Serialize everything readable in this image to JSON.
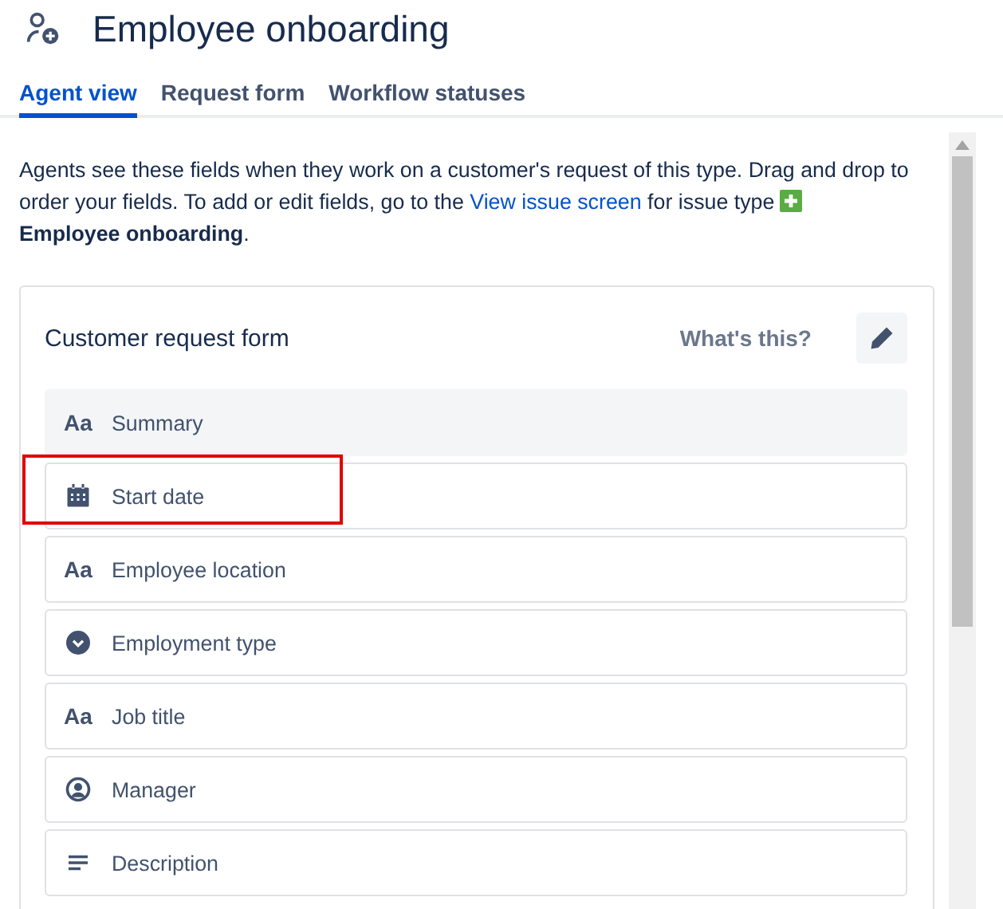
{
  "header": {
    "title": "Employee onboarding"
  },
  "tabs": [
    {
      "label": "Agent view",
      "selected": true
    },
    {
      "label": "Request form",
      "selected": false
    },
    {
      "label": "Workflow statuses",
      "selected": false
    }
  ],
  "intro": {
    "text": "Agents see these fields when they work on a customer's request of this type. Drag and drop to order your fields. To add or edit fields, go to the",
    "link": "View issue screen",
    "after_link": "for issue type",
    "issue_type": "Employee onboarding",
    "end": "."
  },
  "card": {
    "title": "Customer request form",
    "help_link": "What's this?",
    "fields": [
      {
        "kind": "text",
        "glyph": "Aa",
        "label": "Summary",
        "locked": true,
        "highlighted": false
      },
      {
        "kind": "date",
        "label": "Start date",
        "locked": false,
        "highlighted": true
      },
      {
        "kind": "text",
        "glyph": "Aa",
        "label": "Employee location",
        "locked": false,
        "highlighted": false
      },
      {
        "kind": "select",
        "label": "Employment type",
        "locked": false,
        "highlighted": false
      },
      {
        "kind": "text",
        "glyph": "Aa",
        "label": "Job title",
        "locked": false,
        "highlighted": false
      },
      {
        "kind": "user",
        "label": "Manager",
        "locked": false,
        "highlighted": false
      },
      {
        "kind": "paragraph",
        "label": "Description",
        "locked": false,
        "highlighted": false
      }
    ]
  }
}
